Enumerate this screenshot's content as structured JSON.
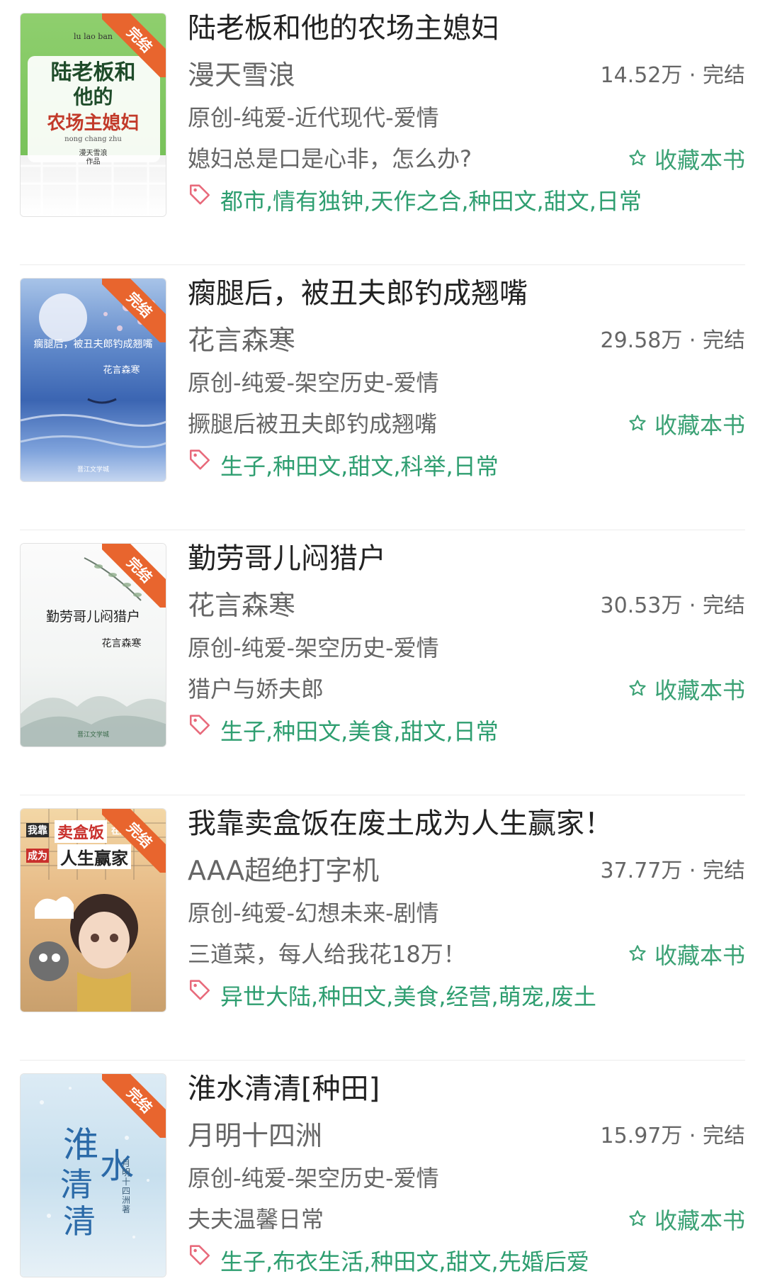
{
  "colors": {
    "accent_green": "#3aa174",
    "ribbon_orange": "#e8652e",
    "tag_icon_red": "#e86a7b"
  },
  "icons": {
    "favorite": "star-outline-icon",
    "tags": "tag-icon"
  },
  "books": [
    {
      "title": "陆老板和他的农场主媳妇",
      "author": "漫天雪浪",
      "stats": "14.52万 · 完结",
      "category": "原创-纯爱-近代现代-爱情",
      "summary": "媳妇总是口是心非，怎么办?",
      "fav_label": "收藏本书",
      "tags": "都市,情有独钟,天作之合,种田文,甜文,日常",
      "cover": {
        "ribbon": "完结",
        "pinyin": "lu lao ban",
        "title_lines": [
          "陆老板和",
          "他的",
          "农场主媳妇"
        ],
        "pinyin2": "nong chang zhu",
        "byline": "漫天雪浪",
        "work": "作品"
      }
    },
    {
      "title": "瘸腿后，被丑夫郎钓成翘嘴",
      "author": "花言森寒",
      "stats": "29.58万 · 完结",
      "category": "原创-纯爱-架空历史-爱情",
      "summary": "撅腿后被丑夫郎钓成翘嘴",
      "fav_label": "收藏本书",
      "tags": "生子,种田文,甜文,科举,日常",
      "cover": {
        "ribbon": "完结",
        "title": "瘸腿后，被丑夫郎钓成翘嘴",
        "author": "花言森寒",
        "publisher": "晋江文学城"
      }
    },
    {
      "title": "勤劳哥儿闷猎户",
      "author": "花言森寒",
      "stats": "30.53万 · 完结",
      "category": "原创-纯爱-架空历史-爱情",
      "summary": "猎户与娇夫郎",
      "fav_label": "收藏本书",
      "tags": "生子,种田文,美食,甜文,日常",
      "cover": {
        "ribbon": "完结",
        "title": "勤劳哥儿闷猎户",
        "author": "花言森寒",
        "publisher": "晋江文学城"
      }
    },
    {
      "title": "我靠卖盒饭在废土成为人生赢家！",
      "author": "AAA超绝打字机",
      "stats": "37.77万 · 完结",
      "category": "原创-纯爱-幻想未来-剧情",
      "summary": "三道菜，每人给我花18万！",
      "fav_label": "收藏本书",
      "tags": "异世大陆,种田文,美食,经营,萌宠,废土",
      "cover": {
        "ribbon": "完结",
        "line1a": "我靠",
        "line1b": "卖盒饭",
        "line1c": "在废土",
        "line2a": "成为",
        "line2b": "人生赢家"
      }
    },
    {
      "title": "淮水清清[种田]",
      "author": "月明十四洲",
      "stats": "15.97万 · 完结",
      "category": "原创-纯爱-架空历史-爱情",
      "summary": "夫夫温馨日常",
      "fav_label": "收藏本书",
      "tags": "生子,布衣生活,种田文,甜文,先婚后爱",
      "cover": {
        "ribbon": "完结",
        "title_a": "淮",
        "title_b": "水",
        "title_c": "清",
        "title_d": "清",
        "author": "月明十四洲著"
      }
    }
  ]
}
